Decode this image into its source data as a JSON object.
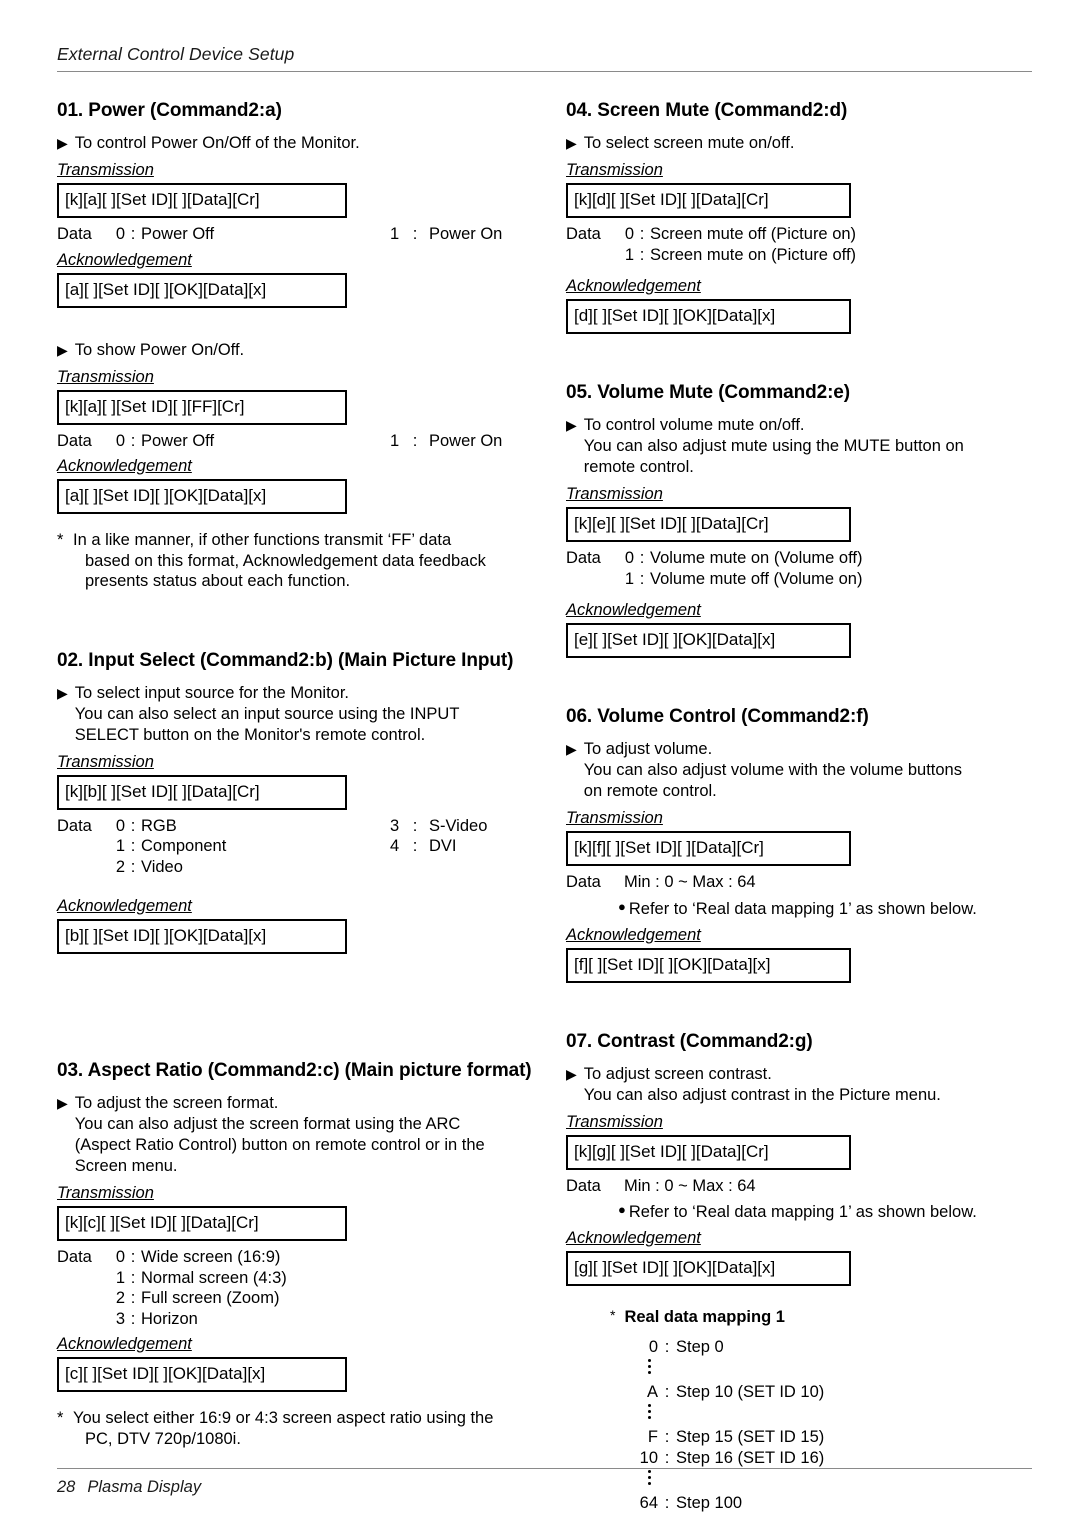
{
  "header": {
    "title": "External Control Device Setup"
  },
  "footer": {
    "page_number": "28",
    "doc_name": "Plasma Display"
  },
  "labels": {
    "transmission": "Transmission",
    "acknowledgement": "Acknowledgement",
    "data": "Data",
    "colon": ":",
    "triangle": "▶",
    "star": "*",
    "dot": "●"
  },
  "sections": {
    "s01": {
      "title": "01. Power (Command2:a)",
      "desc1": "To control Power On/Off of the Monitor.",
      "tx1": "[k][a][  ][Set ID][  ][Data][Cr]",
      "data1": [
        {
          "key": "0",
          "val": "Power Off",
          "key2": "1",
          "val2": "Power On"
        }
      ],
      "ack1": "[a][  ][Set ID][  ][OK][Data][x]",
      "desc2": "To show Power On/Off.",
      "tx2": "[k][a][  ][Set ID][  ][FF][Cr]",
      "data2": [
        {
          "key": "0",
          "val": "Power Off",
          "key2": "1",
          "val2": "Power On"
        }
      ],
      "ack2": "[a][  ][Set ID][  ][OK][Data][x]",
      "note": [
        "In a like manner, if other functions transmit ‘FF’ data",
        "based on this format, Acknowledgement data feedback",
        "presents status about each function."
      ]
    },
    "s02": {
      "title": "02. Input Select (Command2:b) (Main Picture Input)",
      "desc": [
        "To select input source for the Monitor.",
        "You can also select an input source using the INPUT",
        "SELECT button on the Monitor's remote control."
      ],
      "tx": "[k][b][  ][Set ID][  ][Data][Cr]",
      "data": [
        {
          "key": "0",
          "val": "RGB",
          "key2": "3",
          "val2": "S-Video"
        },
        {
          "key": "1",
          "val": "Component",
          "key2": "4",
          "val2": "DVI"
        },
        {
          "key": "2",
          "val": "Video"
        }
      ],
      "ack": "[b][  ][Set ID][  ][OK][Data][x]"
    },
    "s03": {
      "title": "03. Aspect Ratio (Command2:c) (Main picture format)",
      "desc": [
        "To adjust the screen format.",
        "You can also adjust the screen format using the ARC",
        "(Aspect Ratio Control) button on remote control or in the",
        "Screen menu."
      ],
      "tx": "[k][c][  ][Set ID][  ][Data][Cr]",
      "data": [
        {
          "key": "0",
          "val": "Wide screen (16:9)"
        },
        {
          "key": "1",
          "val": "Normal screen (4:3)"
        },
        {
          "key": "2",
          "val": "Full screen (Zoom)"
        },
        {
          "key": "3",
          "val": "Horizon"
        }
      ],
      "ack": "[c][  ][Set ID][  ][OK][Data][x]",
      "note": [
        "You select either 16:9 or 4:3 screen aspect ratio using the",
        "PC, DTV 720p/1080i."
      ]
    },
    "s04": {
      "title": "04. Screen Mute (Command2:d)",
      "desc": [
        "To select screen mute on/off."
      ],
      "tx": "[k][d][  ][Set ID][  ][Data][Cr]",
      "data": [
        {
          "key": "0",
          "val": "Screen mute off (Picture on)"
        },
        {
          "key": "1",
          "val": "Screen mute on (Picture off)"
        }
      ],
      "ack": "[d][  ][Set ID][  ][OK][Data][x]"
    },
    "s05": {
      "title": "05. Volume Mute (Command2:e)",
      "desc": [
        "To control volume mute on/off.",
        "You can also adjust mute using the MUTE button on",
        "remote control."
      ],
      "tx": "[k][e][  ][Set ID][  ][Data][Cr]",
      "data": [
        {
          "key": "0",
          "val": "Volume mute on (Volume off)"
        },
        {
          "key": "1",
          "val": "Volume mute off (Volume on)"
        }
      ],
      "ack": "[e][  ][Set ID][  ][OK][Data][x]"
    },
    "s06": {
      "title": "06. Volume Control (Command2:f)",
      "desc": [
        "To adjust volume.",
        "You can also adjust volume with the volume buttons",
        "on remote control."
      ],
      "tx": "[k][f][  ][Set ID][  ][Data][Cr]",
      "range": "Min : 0 ~ Max : 64",
      "refer": "Refer to ‘Real data mapping 1’ as shown below.",
      "ack": "[f][  ][Set ID][  ][OK][Data][x]"
    },
    "s07": {
      "title": "07. Contrast (Command2:g)",
      "desc": [
        "To adjust screen contrast.",
        "You can also adjust contrast in the Picture menu."
      ],
      "tx": "[k][g][  ][Set ID][  ][Data][Cr]",
      "range": "Min : 0 ~ Max : 64",
      "refer": "Refer to ‘Real data mapping 1’ as shown below.",
      "ack": "[g][  ][Set ID][  ][OK][Data][x]"
    }
  },
  "real_data_mapping": {
    "title": "Real data mapping 1",
    "rows": [
      {
        "key": "0",
        "val": "Step 0"
      },
      {
        "key": "A",
        "val": "Step 10 (SET ID 10)"
      },
      {
        "key": "F",
        "val": "Step 15 (SET ID 15)"
      },
      {
        "key": "10",
        "val": "Step 16 (SET ID 16)"
      },
      {
        "key": "64",
        "val": "Step 100"
      }
    ]
  }
}
